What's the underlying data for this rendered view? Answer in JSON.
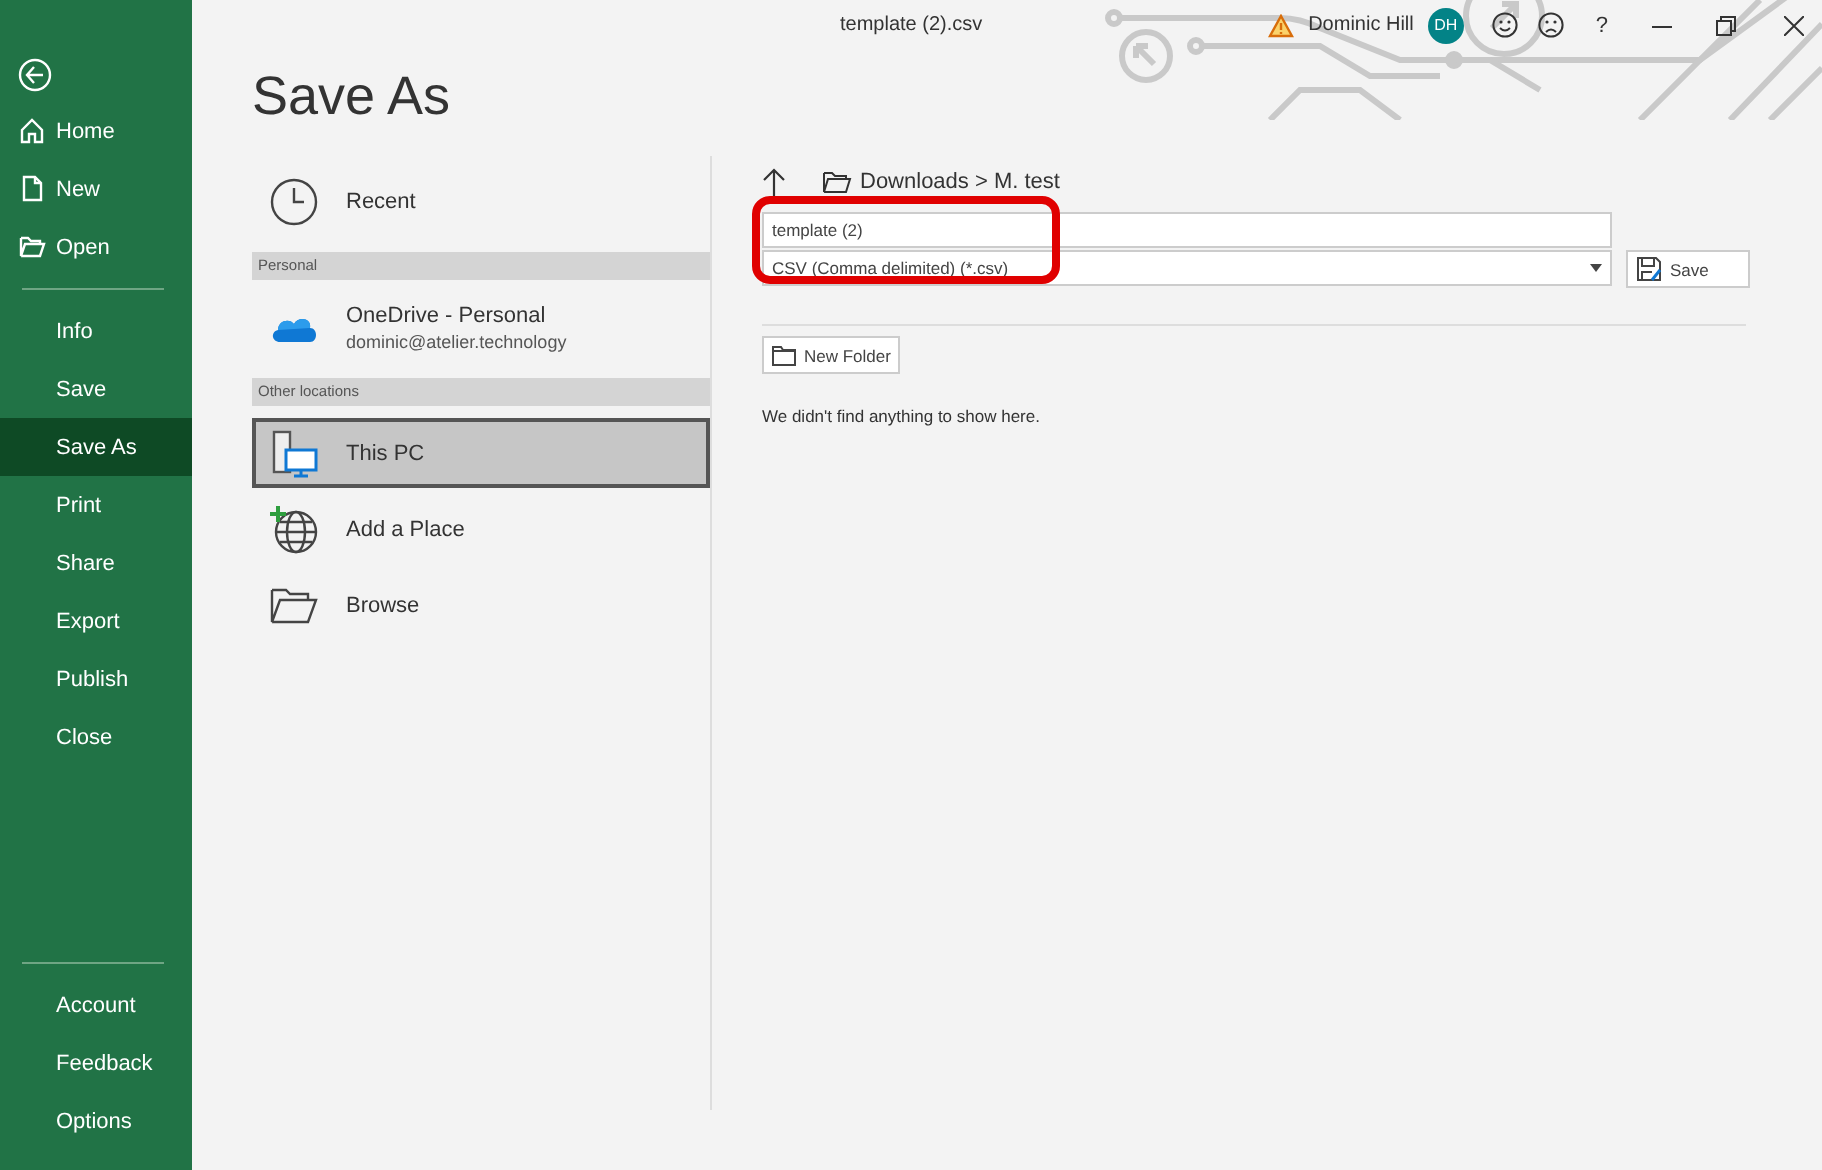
{
  "window": {
    "title": "template (2).csv",
    "help": "?"
  },
  "account": {
    "user_name": "Dominic Hill",
    "initials": "DH"
  },
  "sidebar": {
    "top_items": [
      {
        "label": "Home"
      },
      {
        "label": "New"
      },
      {
        "label": "Open"
      }
    ],
    "items": [
      {
        "label": "Info",
        "selected": false
      },
      {
        "label": "Save",
        "selected": false
      },
      {
        "label": "Save As",
        "selected": true
      },
      {
        "label": "Print",
        "selected": false
      },
      {
        "label": "Share",
        "selected": false
      },
      {
        "label": "Export",
        "selected": false
      },
      {
        "label": "Publish",
        "selected": false
      },
      {
        "label": "Close",
        "selected": false
      }
    ],
    "bottom_items": [
      {
        "label": "Account"
      },
      {
        "label": "Feedback"
      },
      {
        "label": "Options"
      }
    ]
  },
  "page_title": "Save As",
  "locations": [
    {
      "kind": "recent",
      "label": "Recent",
      "selected": false
    },
    {
      "kind": "header",
      "label": "Personal"
    },
    {
      "kind": "onedrive",
      "label": "OneDrive - Personal",
      "sublabel": "dominic@atelier.technology",
      "selected": false
    },
    {
      "kind": "header",
      "label": "Other locations"
    },
    {
      "kind": "pc",
      "label": "This PC",
      "selected": true
    },
    {
      "kind": "add_place",
      "label": "Add a Place",
      "selected": false
    },
    {
      "kind": "browse",
      "label": "Browse",
      "selected": false
    }
  ],
  "save_pane": {
    "breadcrumb": "Downloads > M. test",
    "file_name": "template (2)",
    "file_type": "CSV (Comma delimited) (*.csv)",
    "save_button": "Save",
    "new_folder_button": "New Folder",
    "empty_message": "We didn't find anything to show here.",
    "highlight": true
  }
}
